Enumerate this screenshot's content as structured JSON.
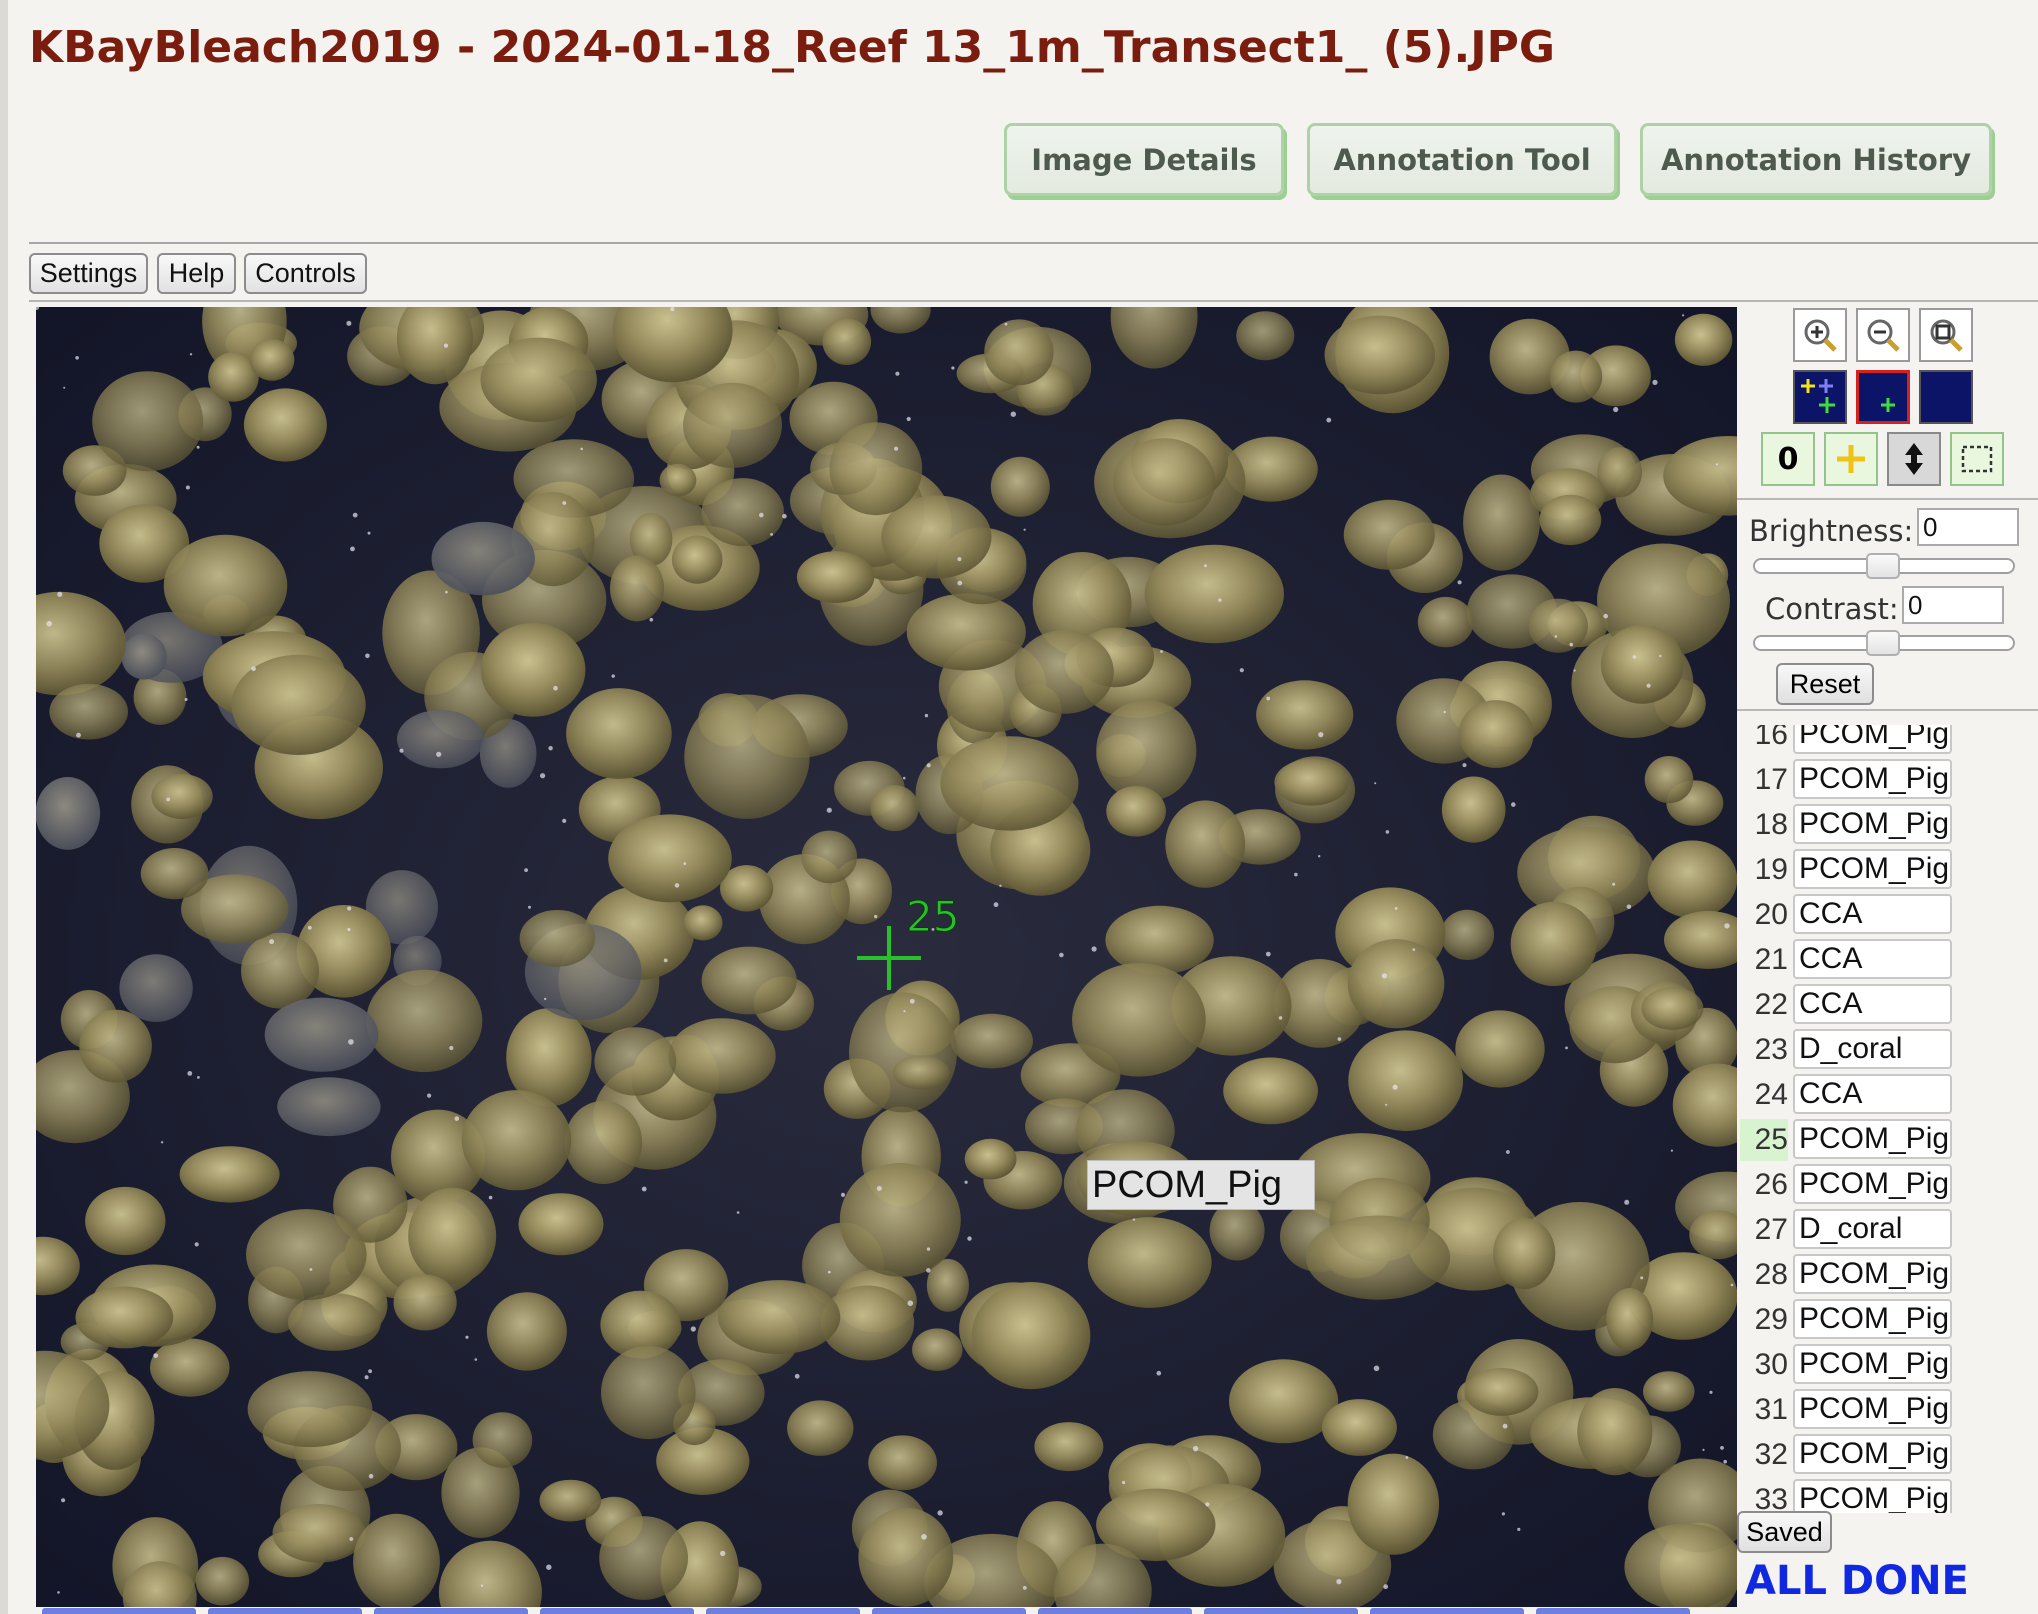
{
  "page": {
    "title": "KBayBleach2019 - 2024-01-18_Reef 13_1m_Transect1_ (5).JPG"
  },
  "tabs": [
    {
      "label": "Image Details"
    },
    {
      "label": "Annotation Tool"
    },
    {
      "label": "Annotation History"
    }
  ],
  "menu": {
    "settings": "Settings",
    "help": "Help",
    "controls": "Controls"
  },
  "viewer": {
    "point_number": "25",
    "hover_label": "PCOM_Pig",
    "marker_color": "#27c22a"
  },
  "toolbar": {
    "zoom_in": "zoom-in-icon",
    "zoom_out": "zoom-out-icon",
    "zoom_fit": "zoom-fit-icon",
    "point_mode_value": "0"
  },
  "adjustments": {
    "brightness_label": "Brightness:",
    "brightness_value": "0",
    "contrast_label": "Contrast:",
    "contrast_value": "0",
    "reset_label": "Reset"
  },
  "annotations": [
    {
      "num": "16",
      "label": "PCOM_Pig"
    },
    {
      "num": "17",
      "label": "PCOM_Pig"
    },
    {
      "num": "18",
      "label": "PCOM_Pig"
    },
    {
      "num": "19",
      "label": "PCOM_Pig"
    },
    {
      "num": "20",
      "label": "CCA"
    },
    {
      "num": "21",
      "label": "CCA"
    },
    {
      "num": "22",
      "label": "CCA"
    },
    {
      "num": "23",
      "label": "D_coral"
    },
    {
      "num": "24",
      "label": "CCA"
    },
    {
      "num": "25",
      "label": "PCOM_Pig",
      "active": true
    },
    {
      "num": "26",
      "label": "PCOM_Pig"
    },
    {
      "num": "27",
      "label": "D_coral"
    },
    {
      "num": "28",
      "label": "PCOM_Pig"
    },
    {
      "num": "29",
      "label": "PCOM_Pig"
    },
    {
      "num": "30",
      "label": "PCOM_Pig"
    },
    {
      "num": "31",
      "label": "PCOM_Pig"
    },
    {
      "num": "32",
      "label": "PCOM_Pig"
    },
    {
      "num": "33",
      "label": "PCOM_Pig"
    }
  ],
  "status": {
    "saved_label": "Saved",
    "done_label": "ALL DONE"
  },
  "colors": {
    "title": "#7a1d0e",
    "tab_border": "#aed2a6",
    "done": "#1029e0",
    "active_row": "#d8f3cf"
  }
}
